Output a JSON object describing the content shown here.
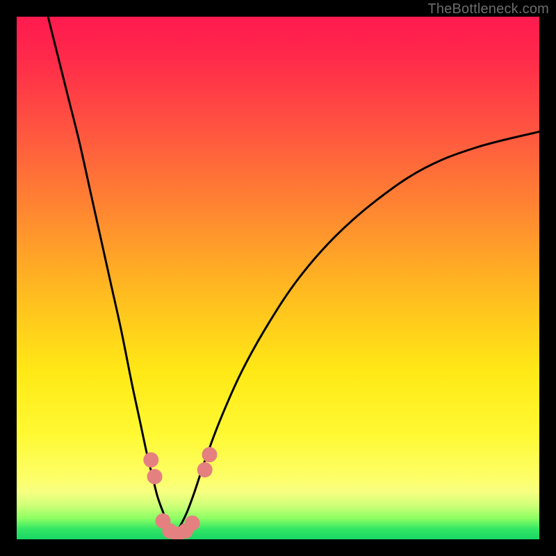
{
  "attribution": "TheBottleneck.com",
  "colors": {
    "frame": "#000000",
    "gradient_top": "#ff1a4f",
    "gradient_mid": "#ffe916",
    "gradient_bottom": "#18d565",
    "curve": "#000000",
    "marker": "#e58080",
    "attribution_text": "#6d6d6d"
  },
  "chart_data": {
    "type": "line",
    "title": "",
    "xlabel": "",
    "ylabel": "",
    "xlim": [
      0,
      100
    ],
    "ylim": [
      0,
      100
    ],
    "grid": false,
    "legend": false,
    "series": [
      {
        "name": "left-branch",
        "x": [
          6,
          8,
          10,
          12,
          14,
          16,
          18,
          20,
          22,
          23.5,
          25,
          26,
          27,
          28.5,
          29.5,
          30
        ],
        "y": [
          100,
          92,
          84,
          76,
          67,
          58,
          49,
          40,
          30,
          23,
          16,
          12,
          8,
          4,
          2,
          0
        ]
      },
      {
        "name": "right-branch",
        "x": [
          30,
          31,
          32.5,
          34,
          36,
          39,
          43,
          48,
          54,
          61,
          69,
          78,
          88,
          100
        ],
        "y": [
          0,
          2,
          5,
          9,
          15,
          23,
          32,
          41,
          50,
          58,
          65,
          71,
          75,
          78
        ]
      }
    ],
    "markers": [
      {
        "name": "left-upper",
        "x": 25.7,
        "y": 15.2
      },
      {
        "name": "left-lower",
        "x": 26.4,
        "y": 12.0
      },
      {
        "name": "valley-1",
        "x": 28.0,
        "y": 3.5
      },
      {
        "name": "valley-2",
        "x": 29.3,
        "y": 1.6
      },
      {
        "name": "valley-3",
        "x": 30.8,
        "y": 1.0
      },
      {
        "name": "valley-4",
        "x": 32.3,
        "y": 1.6
      },
      {
        "name": "valley-5",
        "x": 33.6,
        "y": 3.1
      },
      {
        "name": "right-lower",
        "x": 36.0,
        "y": 13.3
      },
      {
        "name": "right-upper",
        "x": 36.9,
        "y": 16.2
      }
    ],
    "note": "Values are estimated from pixels on a 0-100 normalized axis; x increases left→right, y increases bottom→top."
  }
}
